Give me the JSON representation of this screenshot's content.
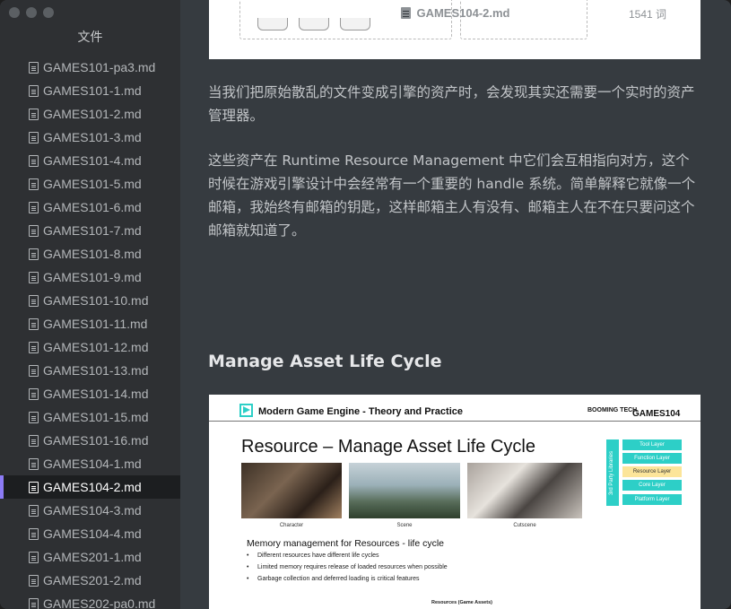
{
  "window": {
    "title": "GAMES104-2.md",
    "word_count": "1541 词"
  },
  "sidebar": {
    "title": "文件",
    "files": [
      "GAMES101-pa3.md",
      "GAMES101-1.md",
      "GAMES101-2.md",
      "GAMES101-3.md",
      "GAMES101-4.md",
      "GAMES101-5.md",
      "GAMES101-6.md",
      "GAMES101-7.md",
      "GAMES101-8.md",
      "GAMES101-9.md",
      "GAMES101-10.md",
      "GAMES101-11.md",
      "GAMES101-12.md",
      "GAMES101-13.md",
      "GAMES101-14.md",
      "GAMES101-15.md",
      "GAMES101-16.md",
      "GAMES104-1.md",
      "GAMES104-2.md",
      "GAMES104-3.md",
      "GAMES104-4.md",
      "GAMES201-1.md",
      "GAMES201-2.md",
      "GAMES202-pa0.md"
    ],
    "active_index": 18
  },
  "content": {
    "paragraph1": "当我们把原始散乱的文件变成引擎的资产时，会发现其实还需要一个实时的资产管理器。",
    "paragraph2": "这些资产在 Runtime Resource Management 中它们会互相指向对方，这个时候在游戏引擎设计中会经常有一个重要的 handle 系统。简单解释它就像一个邮箱，我始终有邮箱的钥匙，这样邮箱主人有没有、邮箱主人在不在只要问这个邮箱就知道了。",
    "heading": "Manage Asset Life Cycle"
  },
  "slide": {
    "brand": "Modern Game Engine - Theory and Practice",
    "logo_booming": "BOOMING TECH",
    "logo_games": "GAMES104",
    "title": "Resource – Manage Asset Life Cycle",
    "captions": [
      "Character",
      "Scene",
      "Cutscene"
    ],
    "bracket_label": "3rd Party Libraries",
    "layers": [
      "Tool Layer",
      "Function Layer",
      "Resource Layer",
      "Core Layer",
      "Platform Layer"
    ],
    "highlight_layer": "Resource Layer",
    "subtitle": "Memory management for Resources - life cycle",
    "bullets": [
      "Different resources have different life cycles",
      "Limited memory requires release of loaded resources when possible",
      "Garbage collection and deferred loading is critical features"
    ],
    "footer": "Resources (Game Assets)"
  },
  "colors": {
    "accent_purple": "#8c7bf5",
    "teal": "#2dcfc7",
    "highlight_yellow": "#fce59a"
  }
}
